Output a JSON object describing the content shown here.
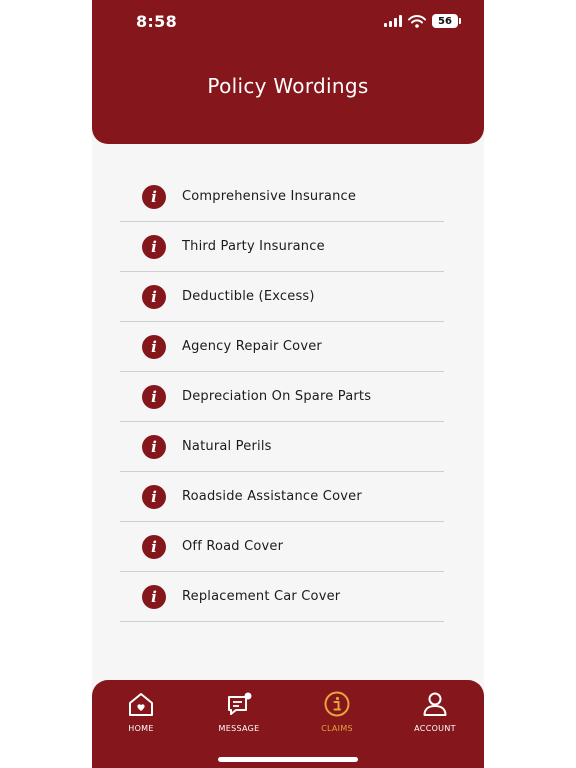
{
  "status_bar": {
    "time": "8:58",
    "battery": "56",
    "icons": [
      "signal-icon",
      "wifi-icon",
      "battery-icon"
    ]
  },
  "header": {
    "title": "Policy Wordings"
  },
  "policy_items": [
    {
      "label": "Comprehensive Insurance",
      "icon": "info-icon"
    },
    {
      "label": "Third Party Insurance",
      "icon": "info-icon"
    },
    {
      "label": "Deductible (Excess)",
      "icon": "info-icon"
    },
    {
      "label": "Agency Repair Cover",
      "icon": "info-icon"
    },
    {
      "label": "Depreciation On Spare Parts",
      "icon": "info-icon"
    },
    {
      "label": "Natural Perils",
      "icon": "info-icon"
    },
    {
      "label": "Roadside Assistance Cover",
      "icon": "info-icon"
    },
    {
      "label": "Off Road Cover",
      "icon": "info-icon"
    },
    {
      "label": "Replacement Car Cover",
      "icon": "info-icon"
    }
  ],
  "bottom_nav": {
    "items": [
      {
        "label": "HOME",
        "icon": "home-heart-icon",
        "active": false
      },
      {
        "label": "MESSAGE",
        "icon": "message-icon",
        "active": false
      },
      {
        "label": "CLAIMS",
        "icon": "info-circle-icon",
        "active": true
      },
      {
        "label": "ACCOUNT",
        "icon": "user-icon",
        "active": false
      }
    ]
  },
  "colors": {
    "brand": "#85161b",
    "active_nav": "#e8a33d",
    "background": "#f6f6f6"
  }
}
